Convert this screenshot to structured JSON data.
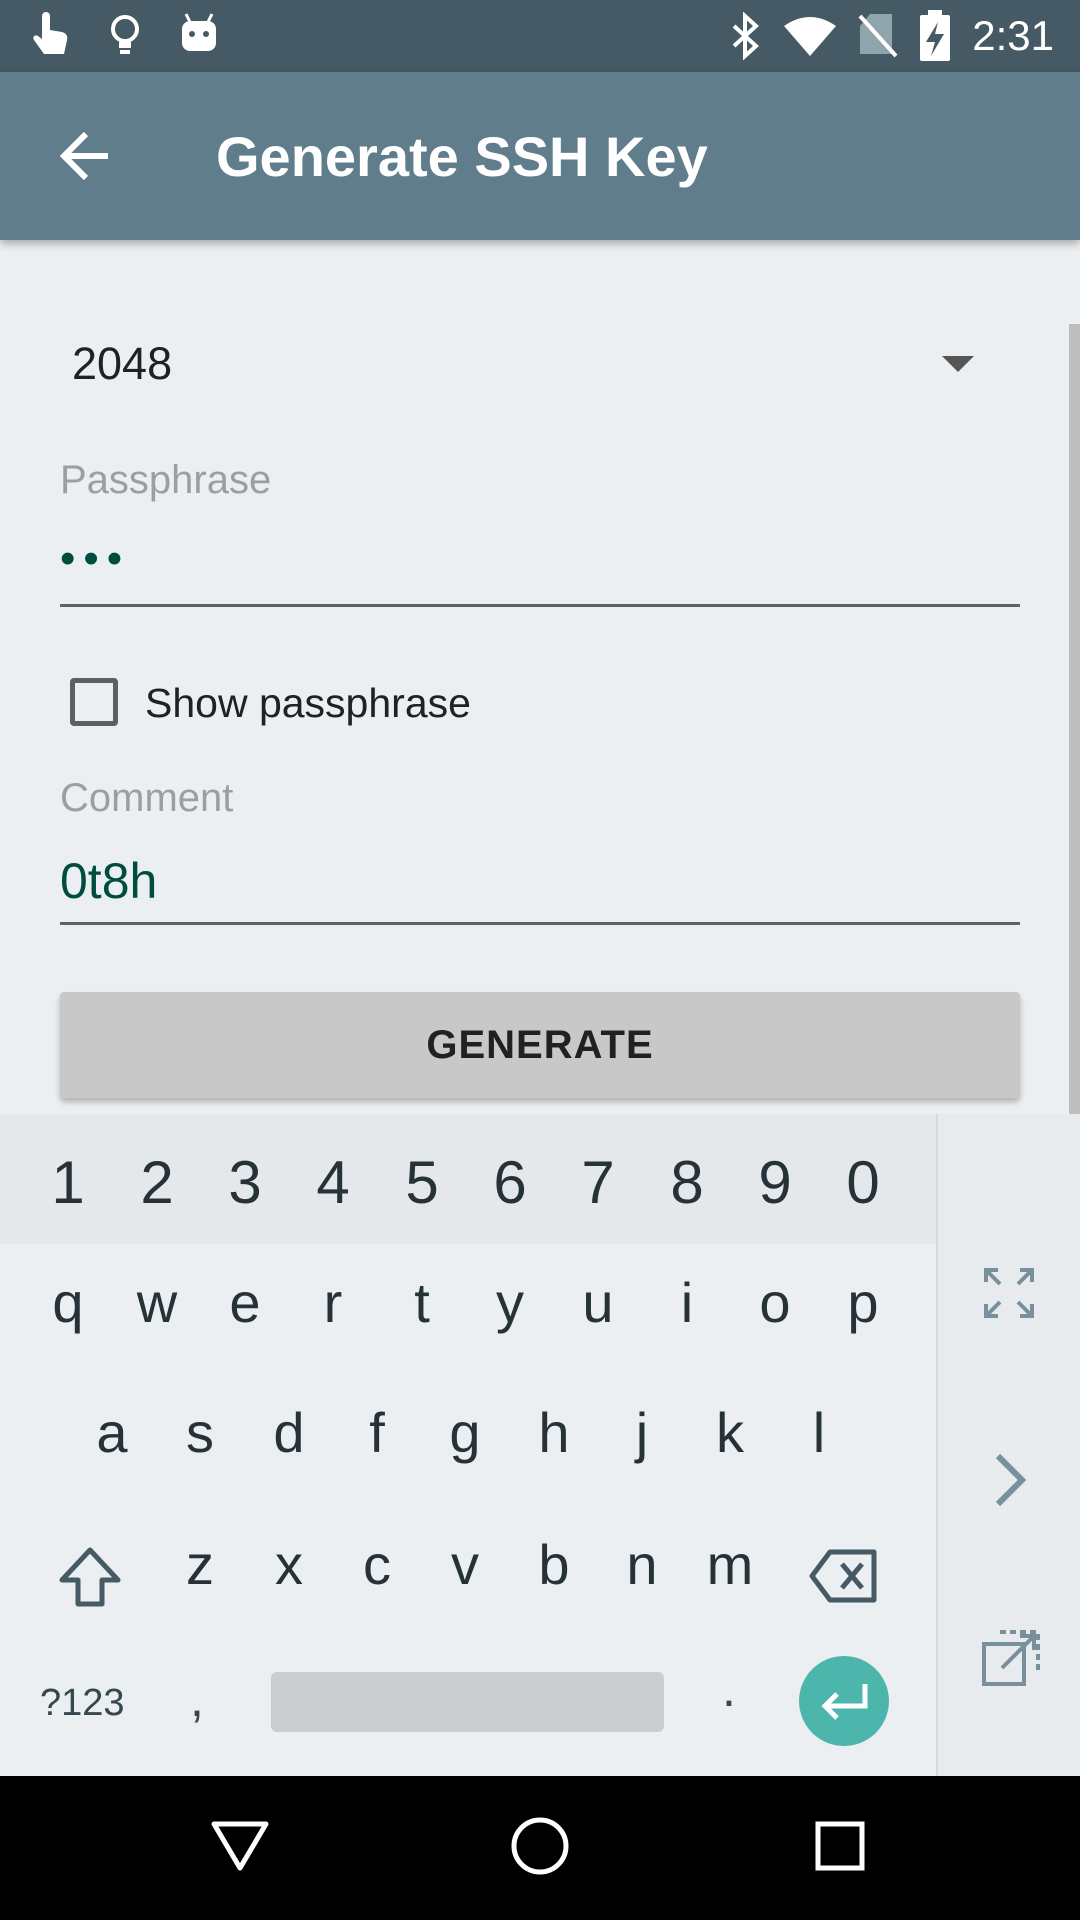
{
  "status_bar": {
    "time": "2:31",
    "left_icons": [
      "touch-icon",
      "lightbulb-icon",
      "android-icon"
    ],
    "right_icons": [
      "bluetooth-icon",
      "wifi-icon",
      "no-sim-icon",
      "battery-charging-icon"
    ]
  },
  "app_bar": {
    "title": "Generate SSH Key",
    "back_icon": "arrow-back-icon"
  },
  "form": {
    "key_size_value": "2048",
    "passphrase_label": "Passphrase",
    "passphrase_value": "•••",
    "show_passphrase_label": "Show passphrase",
    "show_passphrase_checked": false,
    "comment_label": "Comment",
    "comment_value": "0t8h",
    "generate_button": "GENERATE"
  },
  "keyboard": {
    "number_row": [
      "1",
      "2",
      "3",
      "4",
      "5",
      "6",
      "7",
      "8",
      "9",
      "0"
    ],
    "row1": [
      "q",
      "w",
      "e",
      "r",
      "t",
      "y",
      "u",
      "i",
      "o",
      "p"
    ],
    "row2": [
      "a",
      "s",
      "d",
      "f",
      "g",
      "h",
      "j",
      "k",
      "l"
    ],
    "row3": [
      "z",
      "x",
      "c",
      "v",
      "b",
      "n",
      "m"
    ],
    "symbols_key": "?123",
    "comma_key": ",",
    "period_key": ".",
    "side_icons": [
      "fullscreen-icon",
      "chevron-right-icon",
      "open-external-icon"
    ]
  },
  "nav_bar": {
    "icons": [
      "back-triangle-icon",
      "home-circle-icon",
      "recents-square-icon"
    ]
  }
}
